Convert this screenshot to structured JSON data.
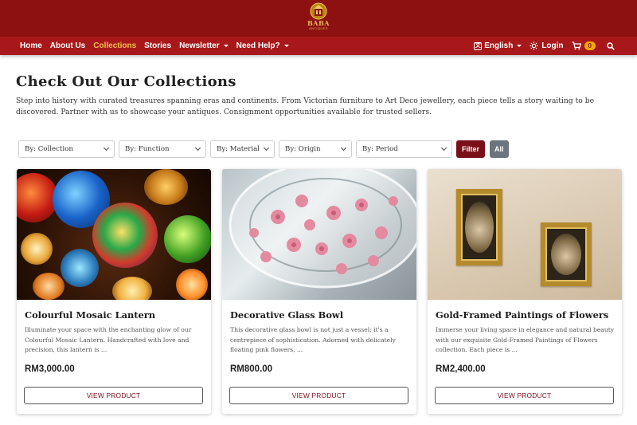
{
  "brand": {
    "logo_text": "BABA",
    "logo_sub": "ANTIQUES"
  },
  "nav": {
    "items": [
      {
        "label": "Home",
        "active": false,
        "dropdown": false
      },
      {
        "label": "About Us",
        "active": false,
        "dropdown": false
      },
      {
        "label": "Collections",
        "active": true,
        "dropdown": false
      },
      {
        "label": "Stories",
        "active": false,
        "dropdown": false
      },
      {
        "label": "Newsletter",
        "active": false,
        "dropdown": true
      },
      {
        "label": "Need Help?",
        "active": false,
        "dropdown": true
      }
    ],
    "language": "English",
    "login": "Login",
    "cart_count": "0"
  },
  "page": {
    "title": "Check Out Our Collections",
    "intro": "Step into history with curated treasures spanning eras and continents. From Victorian furniture to Art Deco jewellery, each piece tells a story waiting to be discovered. Partner with us to showcase your antiques. Consignment opportunities available for trusted sellers."
  },
  "filters": {
    "selects": [
      {
        "label": "By: Collection"
      },
      {
        "label": "By: Function"
      },
      {
        "label": "By: Material"
      },
      {
        "label": "By: Origin"
      },
      {
        "label": "By: Period"
      }
    ],
    "filter_button": "Filter",
    "all_button": "All"
  },
  "products": [
    {
      "title": "Colourful Mosaic Lantern",
      "description": "Illuminate your space with the enchanting glow of our Colourful Mosaic Lantern. Handcrafted with love and precision, this lantern is ...",
      "price": "RM3,000.00",
      "button": "VIEW PRODUCT"
    },
    {
      "title": "Decorative Glass Bowl",
      "description": "This decorative glass bowl is not just a vessel; it's a centrepiece of sophistication. Adorned with delicately floating pink flowers, ...",
      "price": "RM800.00",
      "button": "VIEW PRODUCT"
    },
    {
      "title": "Gold-Framed Paintings of Flowers",
      "description": "Immerse your living space in elegance and natural beauty with our exquisite Gold-Framed Paintings of Flowers collection. Each piece is ...",
      "price": "RM2,400.00",
      "button": "VIEW PRODUCT"
    }
  ],
  "colors": {
    "brand_bar": "#8e1111",
    "nav_bar": "#a8181a",
    "active_nav": "#f2c14e",
    "filter_button": "#7a0f1a",
    "all_button": "#6c757d"
  }
}
